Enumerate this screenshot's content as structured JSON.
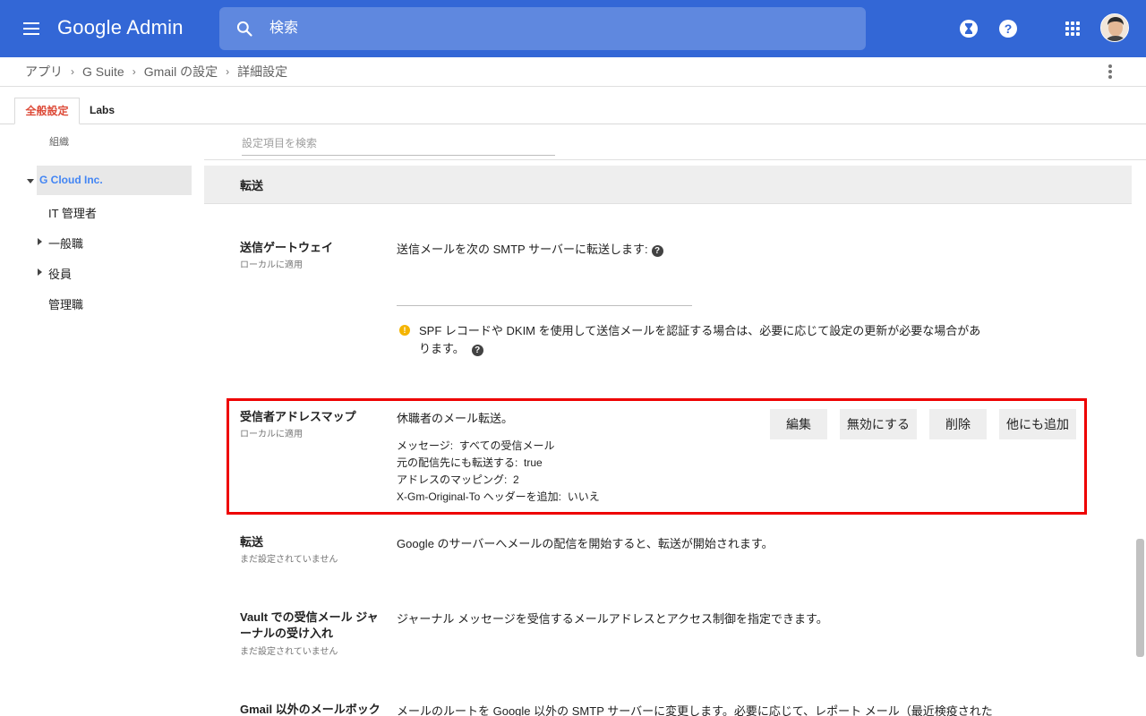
{
  "app": {
    "logo_primary": "Google",
    "logo_secondary": "Admin",
    "search_placeholder": "検索"
  },
  "header_icons": [
    "menu-icon",
    "search-icon",
    "hourglass-icon",
    "help-icon",
    "apps-grid-icon",
    "avatar"
  ],
  "breadcrumb": [
    "アプリ",
    "G Suite",
    "Gmail の設定",
    "詳細設定"
  ],
  "tabs": [
    {
      "label": "全般設定",
      "active": true
    },
    {
      "label": "Labs",
      "active": false
    }
  ],
  "org": {
    "label": "組織",
    "root": "G Cloud Inc.",
    "children": [
      "IT 管理者",
      "一般職",
      "役員",
      "管理職"
    ]
  },
  "filter_placeholder": "設定項目を検索",
  "section_title": "転送",
  "settings": {
    "gateway": {
      "title": "送信ゲートウェイ",
      "sub": "ローカルに適用",
      "desc": "送信メールを次の SMTP サーバーに転送します:",
      "warning": "SPF レコードや DKIM を使用して送信メールを認証する場合は、必要に応じて設定の更新が必要な場合があります。"
    },
    "address_map": {
      "title": "受信者アドレスマップ",
      "sub": "ローカルに適用",
      "heading": "休職者のメール転送。",
      "lines": [
        {
          "key": "メッセージ:",
          "value": "すべての受信メール"
        },
        {
          "key": "元の配信先にも転送する:",
          "value": "true"
        },
        {
          "key": "アドレスのマッピング:",
          "value": "2"
        },
        {
          "key": "X-Gm-Original-To ヘッダーを追加:",
          "value": "いいえ"
        }
      ],
      "buttons": [
        "編集",
        "無効にする",
        "削除",
        "他にも追加"
      ]
    },
    "forwarding": {
      "title": "転送",
      "sub": "まだ設定されていません",
      "desc": "Google のサーバーへメールの配信を開始すると、転送が開始されます。"
    },
    "vault": {
      "title": "Vault での受信メール ジャーナルの受け入れ",
      "sub": "まだ設定されていません",
      "desc": "ジャーナル メッセージを受信するメールアドレスとアクセス制御を指定できます。"
    },
    "non_gmail": {
      "title": "Gmail 以外のメールボック",
      "desc": "メールのルートを Google 以外の SMTP サーバーに変更します。必要に応じて、レポート メール（最近検疫された"
    }
  },
  "colors": {
    "appbar": "#3367d6",
    "active_tab": "#dd4b39",
    "selected_org": "#4285f4",
    "highlight_border": "#ee0000",
    "warning": "#f4b400"
  }
}
